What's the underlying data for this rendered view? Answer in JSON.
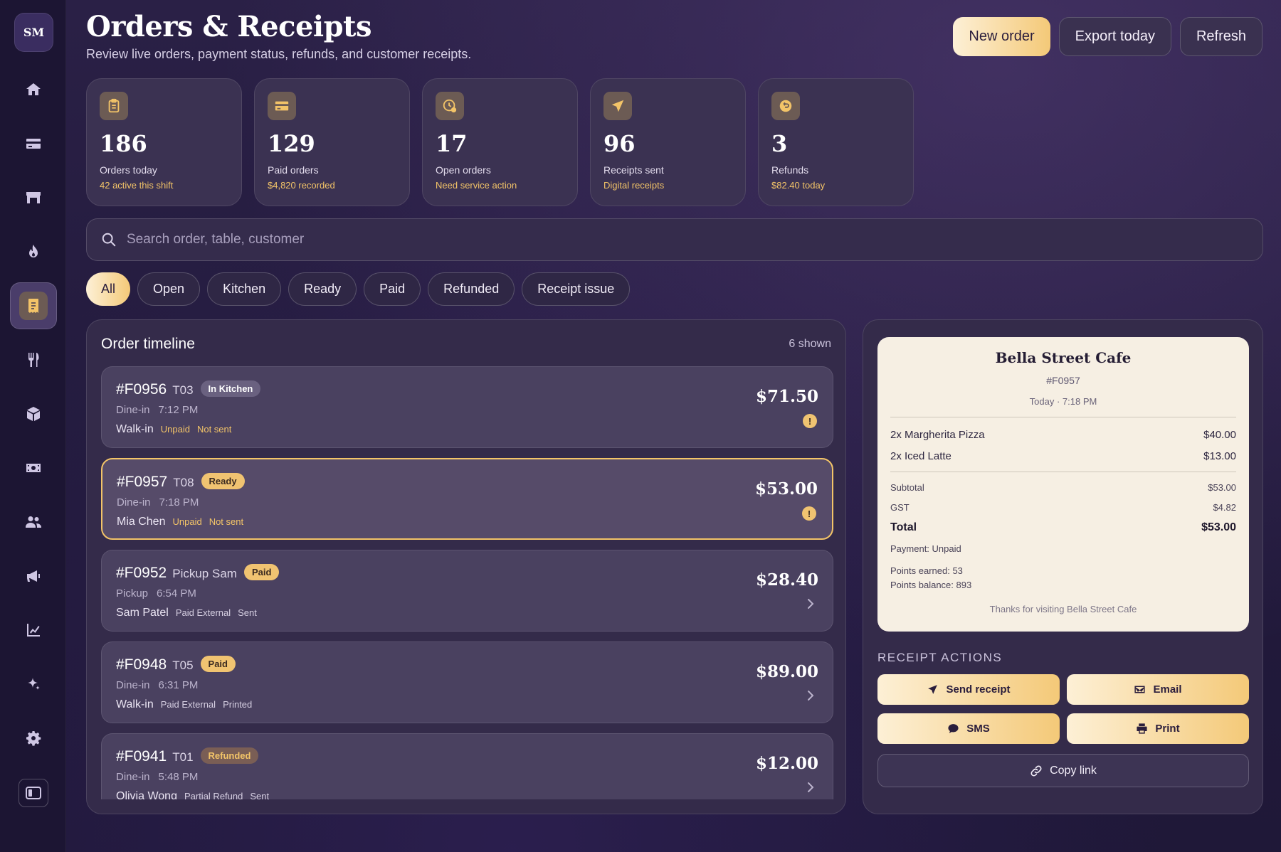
{
  "sidebar": {
    "logo": "SM",
    "items": [
      {
        "icon": "home-icon"
      },
      {
        "icon": "card-icon"
      },
      {
        "icon": "store-icon"
      },
      {
        "icon": "flame-icon"
      },
      {
        "icon": "receipt-icon",
        "active": true
      },
      {
        "icon": "utensils-icon"
      },
      {
        "icon": "box-icon"
      },
      {
        "icon": "cash-icon"
      },
      {
        "icon": "users-icon"
      },
      {
        "icon": "megaphone-icon"
      },
      {
        "icon": "chart-icon"
      },
      {
        "icon": "sparkle-icon"
      },
      {
        "icon": "gear-icon"
      }
    ],
    "collapse_icon": "sidebar-toggle-icon"
  },
  "header": {
    "title": "Orders & Receipts",
    "subtitle": "Review live orders, payment status, refunds, and customer receipts.",
    "buttons": {
      "new_order": "New order",
      "export_today": "Export today",
      "refresh": "Refresh"
    }
  },
  "stats": [
    {
      "icon": "clipboard-icon",
      "value": "186",
      "label": "Orders today",
      "sub": "42 active this shift"
    },
    {
      "icon": "card-icon",
      "value": "129",
      "label": "Paid orders",
      "sub": "$4,820 recorded"
    },
    {
      "icon": "clock-alert-icon",
      "value": "17",
      "label": "Open orders",
      "sub": "Need service action"
    },
    {
      "icon": "send-icon",
      "value": "96",
      "label": "Receipts sent",
      "sub": "Digital receipts"
    },
    {
      "icon": "refund-icon",
      "value": "3",
      "label": "Refunds",
      "sub": "$82.40 today"
    }
  ],
  "search": {
    "placeholder": "Search order, table, customer",
    "value": ""
  },
  "filters": [
    "All",
    "Open",
    "Kitchen",
    "Ready",
    "Paid",
    "Refunded",
    "Receipt issue"
  ],
  "active_filter": "All",
  "timeline": {
    "title": "Order timeline",
    "count": "6 shown",
    "orders": [
      {
        "id": "#F0956",
        "table": "T03",
        "badge": "In Kitchen",
        "type": "Dine-in",
        "time": "7:12 PM",
        "customer": "Walk-in",
        "payment": "Unpaid",
        "receipt": "Not sent",
        "amount": "$71.50",
        "indicator": "alert"
      },
      {
        "id": "#F0957",
        "table": "T08",
        "badge": "Ready",
        "type": "Dine-in",
        "time": "7:18 PM",
        "customer": "Mia Chen",
        "payment": "Unpaid",
        "receipt": "Not sent",
        "amount": "$53.00",
        "indicator": "alert",
        "selected": true
      },
      {
        "id": "#F0952",
        "table": "Pickup Sam",
        "badge": "Paid",
        "type": "Pickup",
        "time": "6:54 PM",
        "customer": "Sam Patel",
        "payment": "Paid External",
        "receipt": "Sent",
        "amount": "$28.40",
        "indicator": "chevron"
      },
      {
        "id": "#F0948",
        "table": "T05",
        "badge": "Paid",
        "type": "Dine-in",
        "time": "6:31 PM",
        "customer": "Walk-in",
        "payment": "Paid External",
        "receipt": "Printed",
        "amount": "$89.00",
        "indicator": "chevron"
      },
      {
        "id": "#F0941",
        "table": "T01",
        "badge": "Refunded",
        "type": "Dine-in",
        "time": "5:48 PM",
        "customer": "Olivia Wong",
        "payment": "Partial Refund",
        "receipt": "Sent",
        "amount": "$12.00",
        "indicator": "chevron"
      }
    ]
  },
  "receipt": {
    "store": "Bella Street Cafe",
    "order_id": "#F0957",
    "time": "Today · 7:18 PM",
    "items": [
      {
        "name": "2x Margherita Pizza",
        "price": "$40.00"
      },
      {
        "name": "2x Iced Latte",
        "price": "$13.00"
      }
    ],
    "subtotal_label": "Subtotal",
    "subtotal": "$53.00",
    "gst_label": "GST",
    "gst": "$4.82",
    "total_label": "Total",
    "total": "$53.00",
    "payment": "Payment: Unpaid",
    "points_earned": "Points earned: 53",
    "points_balance": "Points balance: 893",
    "thanks": "Thanks for visiting Bella Street Cafe"
  },
  "receipt_actions": {
    "label": "RECEIPT ACTIONS",
    "send_receipt": "Send receipt",
    "email": "Email",
    "sms": "SMS",
    "print": "Print",
    "copy_link": "Copy link"
  },
  "colors": {
    "accent": "#f3c468",
    "background": "#231a3d",
    "panel": "#342b4a",
    "receipt_paper": "#f6efe3"
  }
}
